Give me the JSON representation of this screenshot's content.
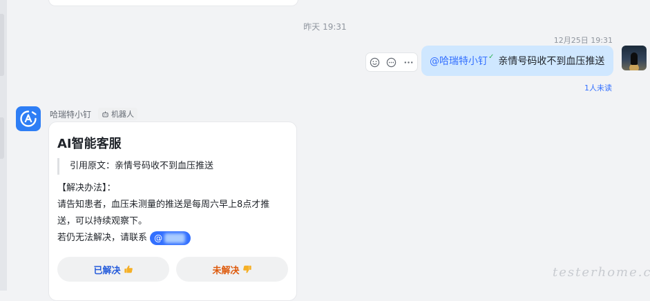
{
  "chat": {
    "timestamp_center": "昨天 19:31",
    "outgoing": {
      "time": "12月25日 19:31",
      "mention": "@哈瑞特小钉",
      "text": "亲情号码收不到血压推送",
      "read_status": "1人未读"
    },
    "bot": {
      "name": "哈瑞特小钉",
      "tag": "机器人"
    },
    "card": {
      "title": "AI智能客服",
      "quote": "引用原文：亲情号码收不到血压推送",
      "section_heading": "【解决办法】：",
      "line1": "请告知患者，血压未测量的推送是每周六早上8点才推",
      "line2": "送，可以持续观察下。",
      "line3": "若仍无法解决，请联系",
      "at_symbol": "@",
      "btn_solved": "已解决",
      "btn_unsolved": "未解决"
    },
    "watermark": "testerhome.com",
    "colors": {
      "accent": "#3370ff",
      "bubble": "#cfe7ff",
      "solved": "#245bdb",
      "unsolved": "#de5a0c"
    }
  }
}
